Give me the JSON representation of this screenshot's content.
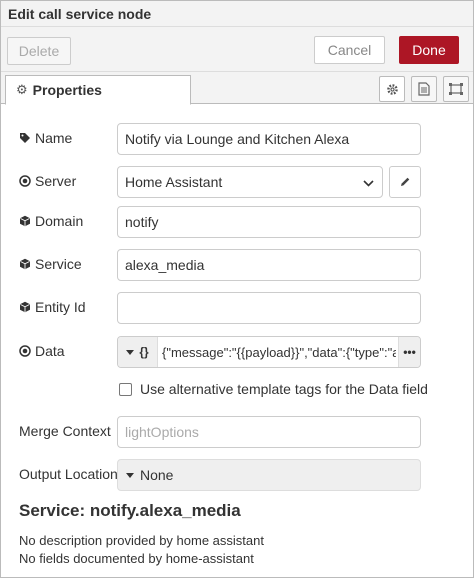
{
  "window": {
    "title": "Edit call service node"
  },
  "toolbar": {
    "delete_label": "Delete",
    "cancel_label": "Cancel",
    "done_label": "Done"
  },
  "tabs": {
    "properties_label": "Properties"
  },
  "form": {
    "name": {
      "label": "Name",
      "value": "Notify via Lounge and Kitchen Alexa"
    },
    "server": {
      "label": "Server",
      "value": "Home Assistant"
    },
    "domain": {
      "label": "Domain",
      "value": "notify"
    },
    "service": {
      "label": "Service",
      "value": "alexa_media"
    },
    "entity_id": {
      "label": "Entity Id",
      "value": ""
    },
    "data": {
      "label": "Data",
      "type": "{}",
      "value": "{\"message\":\"{{payload}}\",\"data\":{\"type\":\"announce\"}}"
    },
    "alt_template": {
      "label": "Use alternative template tags for the Data field",
      "checked": false
    },
    "merge_context": {
      "label": "Merge Context",
      "placeholder": "lightOptions"
    },
    "output_location": {
      "label": "Output Location",
      "value": "None"
    }
  },
  "service_info": {
    "heading": "Service: notify.alexa_media",
    "line1": "No description provided by home assistant",
    "line2": "No fields documented by home-assistant"
  },
  "colors": {
    "done_bg": "#ad1625",
    "border": "#cccccc",
    "panel_bg": "#f3f3f3"
  }
}
